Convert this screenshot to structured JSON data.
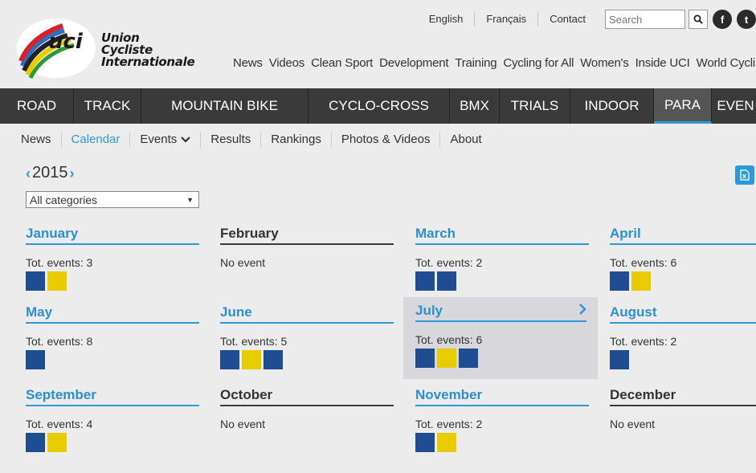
{
  "header": {
    "logo_lines": [
      "Union",
      "Cycliste",
      "Internationale"
    ],
    "logo_mark_text": "uci",
    "top_links": [
      "English",
      "Français",
      "Contact"
    ],
    "search_placeholder": "Search",
    "social": [
      "facebook-icon",
      "twitter-icon"
    ],
    "main_nav": [
      "News",
      "Videos",
      "Clean Sport",
      "Development",
      "Training",
      "Cycling for All",
      "Women's",
      "Inside UCI",
      "World Cycling"
    ]
  },
  "disciplines": [
    {
      "label": "ROAD",
      "active": false
    },
    {
      "label": "TRACK",
      "active": false
    },
    {
      "label": "MOUNTAIN BIKE",
      "active": false
    },
    {
      "label": "CYCLO-CROSS",
      "active": false
    },
    {
      "label": "BMX",
      "active": false
    },
    {
      "label": "TRIALS",
      "active": false
    },
    {
      "label": "INDOOR",
      "active": false
    },
    {
      "label": "PARA",
      "active": true
    },
    {
      "label": "EVEN",
      "active": false
    }
  ],
  "sub_nav": [
    {
      "label": "News",
      "active": false
    },
    {
      "label": "Calendar",
      "active": true
    },
    {
      "label": "Events",
      "active": false,
      "dropdown": true
    },
    {
      "label": "Results",
      "active": false
    },
    {
      "label": "Rankings",
      "active": false
    },
    {
      "label": "Photos & Videos",
      "active": false
    },
    {
      "label": "About",
      "active": false
    }
  ],
  "calendar": {
    "year": "2015",
    "category_filter": "All categories",
    "months": [
      {
        "name": "January",
        "count_label": "Tot. events: 3",
        "swatches": [
          "blue",
          "yellow"
        ]
      },
      {
        "name": "February",
        "count_label": "No event",
        "swatches": []
      },
      {
        "name": "March",
        "count_label": "Tot. events: 2",
        "swatches": [
          "blue",
          "blue"
        ]
      },
      {
        "name": "April",
        "count_label": "Tot. events: 6",
        "swatches": [
          "blue",
          "yellow"
        ]
      },
      {
        "name": "May",
        "count_label": "Tot. events: 8",
        "swatches": [
          "blue"
        ]
      },
      {
        "name": "June",
        "count_label": "Tot. events: 5",
        "swatches": [
          "blue",
          "yellow",
          "blue"
        ]
      },
      {
        "name": "July",
        "count_label": "Tot. events: 6",
        "swatches": [
          "blue",
          "yellow",
          "blue"
        ],
        "highlighted": true
      },
      {
        "name": "August",
        "count_label": "Tot. events: 2",
        "swatches": [
          "blue"
        ]
      },
      {
        "name": "September",
        "count_label": "Tot. events: 4",
        "swatches": [
          "blue",
          "yellow"
        ]
      },
      {
        "name": "October",
        "count_label": "No event",
        "swatches": []
      },
      {
        "name": "November",
        "count_label": "Tot. events: 2",
        "swatches": [
          "blue",
          "yellow"
        ]
      },
      {
        "name": "December",
        "count_label": "No event",
        "swatches": []
      }
    ]
  },
  "colors": {
    "accent": "#2b9ad6",
    "event_blue": "#1e4d91",
    "event_yellow": "#e8cc00",
    "bar_dark": "#3a3a3a"
  }
}
